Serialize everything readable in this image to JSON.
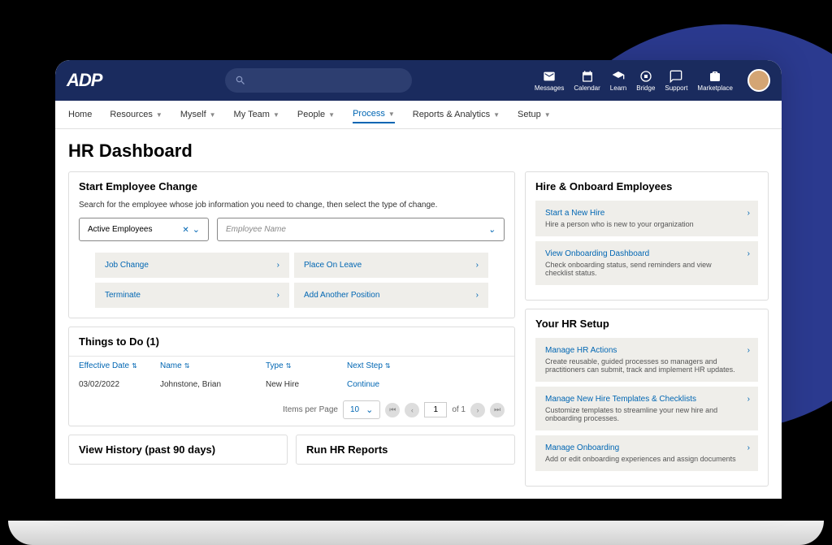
{
  "topbar": {
    "logo": "ADP",
    "items": [
      {
        "label": "Messages",
        "icon": "mail"
      },
      {
        "label": "Calendar",
        "icon": "calendar"
      },
      {
        "label": "Learn",
        "icon": "grad"
      },
      {
        "label": "Bridge",
        "icon": "bridge"
      },
      {
        "label": "Support",
        "icon": "chat"
      },
      {
        "label": "Marketplace",
        "icon": "bag"
      }
    ]
  },
  "nav": {
    "items": [
      "Home",
      "Resources",
      "Myself",
      "My Team",
      "People",
      "Process",
      "Reports & Analytics",
      "Setup"
    ],
    "active": "Process"
  },
  "page": {
    "title": "HR Dashboard"
  },
  "start_change": {
    "title": "Start Employee Change",
    "help": "Search for the employee whose job information you need to change, then select the type of change.",
    "sel1": "Active Employees",
    "sel2_placeholder": "Employee Name",
    "actions": [
      "Job Change",
      "Place On Leave",
      "Terminate",
      "Add Another Position"
    ]
  },
  "things": {
    "title": "Things to Do (1)",
    "cols": [
      "Effective Date",
      "Name",
      "Type",
      "Next Step"
    ],
    "rows": [
      {
        "date": "03/02/2022",
        "name": "Johnstone, Brian",
        "type": "New Hire",
        "next": "Continue"
      }
    ],
    "pagination": {
      "ipp_label": "Items per Page",
      "ipp": "10",
      "page": "1",
      "total": "of 1"
    }
  },
  "bottom": {
    "history": "View History (past 90 days)",
    "reports": "Run HR Reports"
  },
  "hire": {
    "title": "Hire & Onboard Employees",
    "items": [
      {
        "title": "Start a New Hire",
        "desc": "Hire a person who is new to your organization"
      },
      {
        "title": "View Onboarding Dashboard",
        "desc": "Check onboarding status, send reminders and view checklist status."
      }
    ]
  },
  "setup": {
    "title": "Your HR Setup",
    "items": [
      {
        "title": "Manage HR Actions",
        "desc": "Create reusable, guided processes so managers and practitioners can submit, track and implement HR updates."
      },
      {
        "title": "Manage New Hire Templates & Checklists",
        "desc": "Customize templates to streamline your new hire and onboarding processes."
      },
      {
        "title": "Manage Onboarding",
        "desc": "Add or edit onboarding experiences and assign documents"
      }
    ]
  }
}
